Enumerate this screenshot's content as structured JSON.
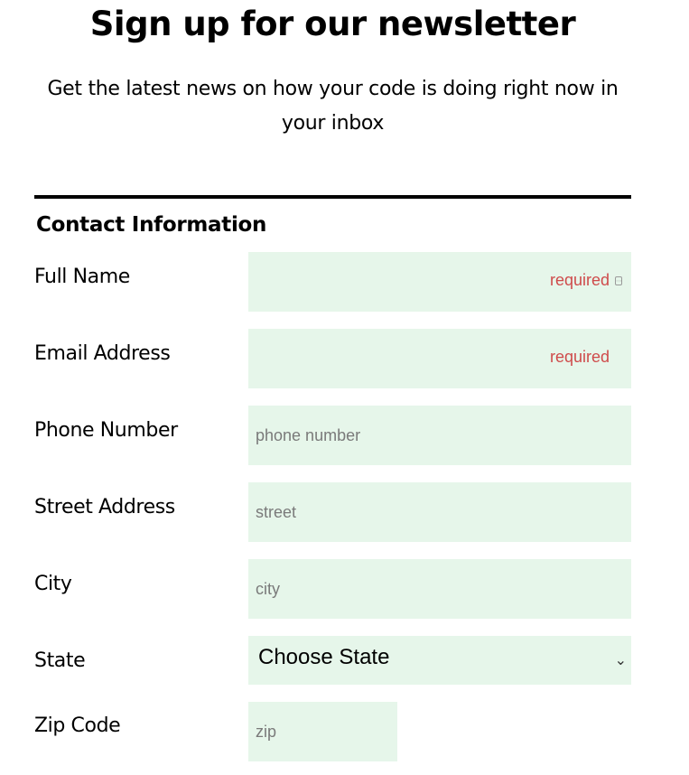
{
  "header": {
    "title": "Sign up for our newsletter",
    "subtitle": "Get the latest news on how your code is doing right now in your inbox"
  },
  "form": {
    "section_title": "Contact Information",
    "full_name": {
      "label": "Full Name",
      "value": "",
      "required_text": "required"
    },
    "email": {
      "label": "Email Address",
      "value": "",
      "required_text": "required"
    },
    "phone": {
      "label": "Phone Number",
      "placeholder": "phone number",
      "value": ""
    },
    "street": {
      "label": "Street Address",
      "placeholder": "street",
      "value": ""
    },
    "city": {
      "label": "City",
      "placeholder": "city",
      "value": ""
    },
    "state": {
      "label": "State",
      "selected": "Choose State"
    },
    "zip": {
      "label": "Zip Code",
      "placeholder": "zip",
      "value": ""
    }
  },
  "colors": {
    "field_bg": "#e6f6ea",
    "required_text": "#cf4b4b",
    "placeholder": "#7a7a7a"
  },
  "icons": {
    "full_name_field": "password-manager-icon",
    "state_select": "chevron-down-icon"
  }
}
